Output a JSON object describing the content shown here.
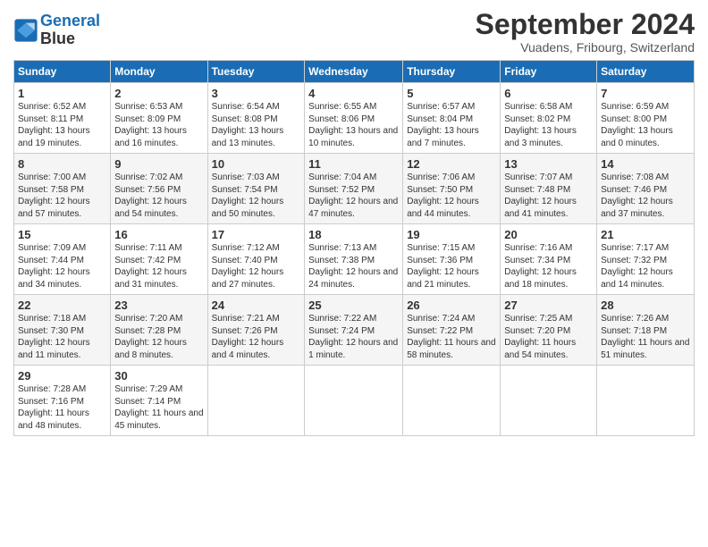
{
  "header": {
    "logo_line1": "General",
    "logo_line2": "Blue",
    "month_title": "September 2024",
    "subtitle": "Vuadens, Fribourg, Switzerland"
  },
  "weekdays": [
    "Sunday",
    "Monday",
    "Tuesday",
    "Wednesday",
    "Thursday",
    "Friday",
    "Saturday"
  ],
  "weeks": [
    [
      {
        "day": "1",
        "sunrise": "6:52 AM",
        "sunset": "8:11 PM",
        "daylight": "13 hours and 19 minutes."
      },
      {
        "day": "2",
        "sunrise": "6:53 AM",
        "sunset": "8:09 PM",
        "daylight": "13 hours and 16 minutes."
      },
      {
        "day": "3",
        "sunrise": "6:54 AM",
        "sunset": "8:08 PM",
        "daylight": "13 hours and 13 minutes."
      },
      {
        "day": "4",
        "sunrise": "6:55 AM",
        "sunset": "8:06 PM",
        "daylight": "13 hours and 10 minutes."
      },
      {
        "day": "5",
        "sunrise": "6:57 AM",
        "sunset": "8:04 PM",
        "daylight": "13 hours and 7 minutes."
      },
      {
        "day": "6",
        "sunrise": "6:58 AM",
        "sunset": "8:02 PM",
        "daylight": "13 hours and 3 minutes."
      },
      {
        "day": "7",
        "sunrise": "6:59 AM",
        "sunset": "8:00 PM",
        "daylight": "13 hours and 0 minutes."
      }
    ],
    [
      {
        "day": "8",
        "sunrise": "7:00 AM",
        "sunset": "7:58 PM",
        "daylight": "12 hours and 57 minutes."
      },
      {
        "day": "9",
        "sunrise": "7:02 AM",
        "sunset": "7:56 PM",
        "daylight": "12 hours and 54 minutes."
      },
      {
        "day": "10",
        "sunrise": "7:03 AM",
        "sunset": "7:54 PM",
        "daylight": "12 hours and 50 minutes."
      },
      {
        "day": "11",
        "sunrise": "7:04 AM",
        "sunset": "7:52 PM",
        "daylight": "12 hours and 47 minutes."
      },
      {
        "day": "12",
        "sunrise": "7:06 AM",
        "sunset": "7:50 PM",
        "daylight": "12 hours and 44 minutes."
      },
      {
        "day": "13",
        "sunrise": "7:07 AM",
        "sunset": "7:48 PM",
        "daylight": "12 hours and 41 minutes."
      },
      {
        "day": "14",
        "sunrise": "7:08 AM",
        "sunset": "7:46 PM",
        "daylight": "12 hours and 37 minutes."
      }
    ],
    [
      {
        "day": "15",
        "sunrise": "7:09 AM",
        "sunset": "7:44 PM",
        "daylight": "12 hours and 34 minutes."
      },
      {
        "day": "16",
        "sunrise": "7:11 AM",
        "sunset": "7:42 PM",
        "daylight": "12 hours and 31 minutes."
      },
      {
        "day": "17",
        "sunrise": "7:12 AM",
        "sunset": "7:40 PM",
        "daylight": "12 hours and 27 minutes."
      },
      {
        "day": "18",
        "sunrise": "7:13 AM",
        "sunset": "7:38 PM",
        "daylight": "12 hours and 24 minutes."
      },
      {
        "day": "19",
        "sunrise": "7:15 AM",
        "sunset": "7:36 PM",
        "daylight": "12 hours and 21 minutes."
      },
      {
        "day": "20",
        "sunrise": "7:16 AM",
        "sunset": "7:34 PM",
        "daylight": "12 hours and 18 minutes."
      },
      {
        "day": "21",
        "sunrise": "7:17 AM",
        "sunset": "7:32 PM",
        "daylight": "12 hours and 14 minutes."
      }
    ],
    [
      {
        "day": "22",
        "sunrise": "7:18 AM",
        "sunset": "7:30 PM",
        "daylight": "12 hours and 11 minutes."
      },
      {
        "day": "23",
        "sunrise": "7:20 AM",
        "sunset": "7:28 PM",
        "daylight": "12 hours and 8 minutes."
      },
      {
        "day": "24",
        "sunrise": "7:21 AM",
        "sunset": "7:26 PM",
        "daylight": "12 hours and 4 minutes."
      },
      {
        "day": "25",
        "sunrise": "7:22 AM",
        "sunset": "7:24 PM",
        "daylight": "12 hours and 1 minute."
      },
      {
        "day": "26",
        "sunrise": "7:24 AM",
        "sunset": "7:22 PM",
        "daylight": "11 hours and 58 minutes."
      },
      {
        "day": "27",
        "sunrise": "7:25 AM",
        "sunset": "7:20 PM",
        "daylight": "11 hours and 54 minutes."
      },
      {
        "day": "28",
        "sunrise": "7:26 AM",
        "sunset": "7:18 PM",
        "daylight": "11 hours and 51 minutes."
      }
    ],
    [
      {
        "day": "29",
        "sunrise": "7:28 AM",
        "sunset": "7:16 PM",
        "daylight": "11 hours and 48 minutes."
      },
      {
        "day": "30",
        "sunrise": "7:29 AM",
        "sunset": "7:14 PM",
        "daylight": "11 hours and 45 minutes."
      },
      null,
      null,
      null,
      null,
      null
    ]
  ]
}
